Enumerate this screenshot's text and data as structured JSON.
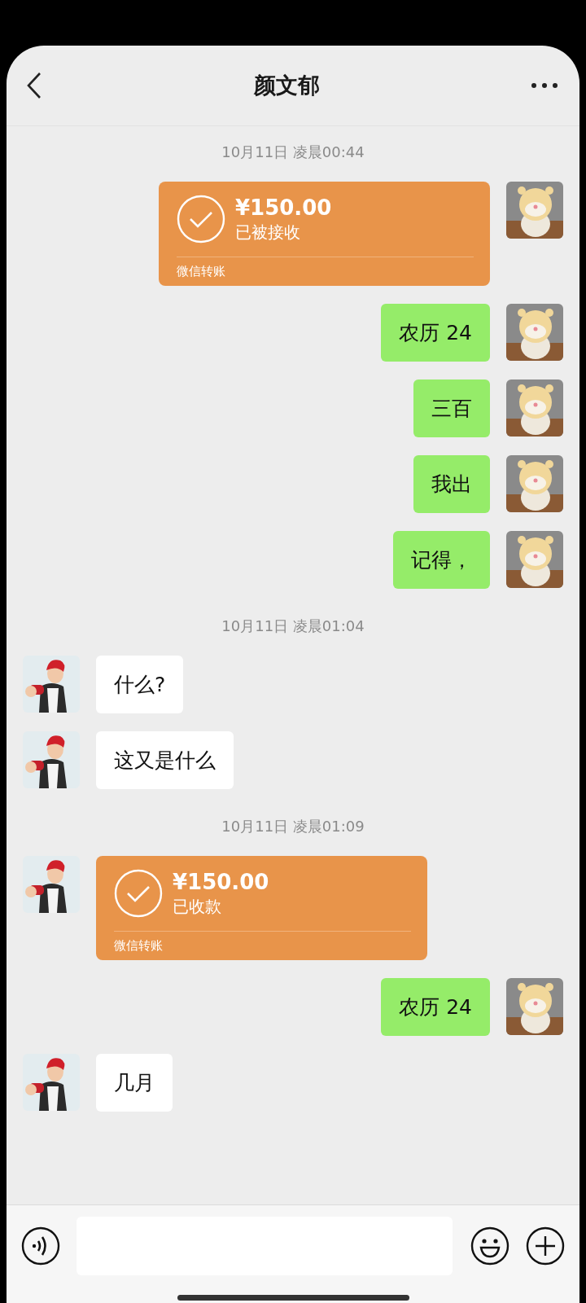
{
  "header": {
    "title": "颜文郁"
  },
  "messages": [
    {
      "kind": "time",
      "text": "10月11日 凌晨00:44"
    },
    {
      "kind": "transfer",
      "outgoing": true,
      "amount": "¥150.00",
      "status": "已被接收",
      "label": "微信转账"
    },
    {
      "kind": "text",
      "outgoing": true,
      "text": "农历 24"
    },
    {
      "kind": "text",
      "outgoing": true,
      "text": "三百"
    },
    {
      "kind": "text",
      "outgoing": true,
      "text": "我出"
    },
    {
      "kind": "text",
      "outgoing": true,
      "text": "记得，"
    },
    {
      "kind": "time",
      "text": "10月11日 凌晨01:04"
    },
    {
      "kind": "text",
      "outgoing": false,
      "text": "什么?"
    },
    {
      "kind": "text",
      "outgoing": false,
      "text": "这又是什么"
    },
    {
      "kind": "time",
      "text": "10月11日 凌晨01:09"
    },
    {
      "kind": "transfer",
      "outgoing": false,
      "amount": "¥150.00",
      "status": "已收款",
      "label": "微信转账"
    },
    {
      "kind": "text",
      "outgoing": true,
      "text": "农历 24"
    },
    {
      "kind": "text",
      "outgoing": false,
      "text": "几月"
    }
  ]
}
